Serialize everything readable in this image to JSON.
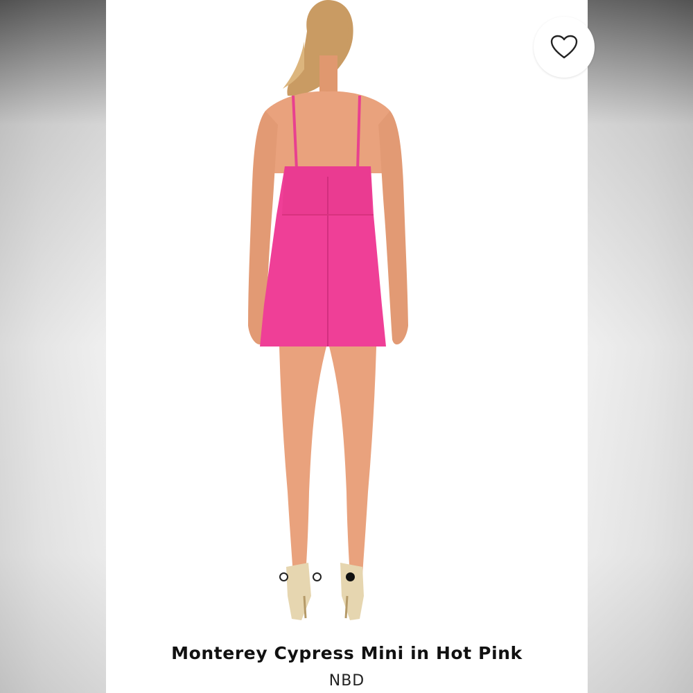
{
  "product": {
    "title": "Monterey Cypress Mini in Hot Pink",
    "brand": "NBD",
    "image": {
      "description": "Model shown from back wearing hot pink spaghetti-strap mini dress with gold heels",
      "dress_color": "#ef3f97",
      "skin_color": "#e9a27d",
      "hair_color": "#c99b63"
    },
    "carousel": {
      "total": 3,
      "active_index": 2
    },
    "favorite_icon": "heart-outline-icon"
  }
}
